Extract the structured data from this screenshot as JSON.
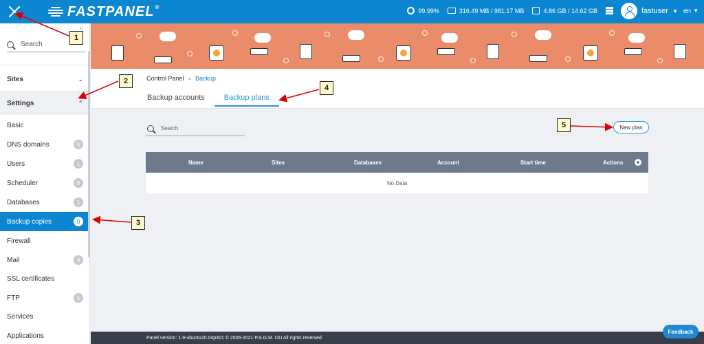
{
  "topbar": {
    "logo_text": "FASTPANEL",
    "logo_reg": "®",
    "uptime": "99.99%",
    "ram": "316.49 MB / 981.17 MB",
    "disk": "4.86 GB / 14.62 GB",
    "username": "fastuser",
    "language": "en",
    "brand_color": "#0d86d1"
  },
  "sidebar": {
    "search_placeholder": "Search",
    "sections": {
      "sites": "Sites",
      "settings": "Settings"
    },
    "items": [
      {
        "label": "Basic",
        "badge": ""
      },
      {
        "label": "DNS domains",
        "badge": "0"
      },
      {
        "label": "Users",
        "badge": "1"
      },
      {
        "label": "Scheduler",
        "badge": "0"
      },
      {
        "label": "Databases",
        "badge": "1"
      },
      {
        "label": "Backup copies",
        "badge": "0"
      },
      {
        "label": "Firewall",
        "badge": ""
      },
      {
        "label": "Mail",
        "badge": "0"
      },
      {
        "label": "SSL certificates",
        "badge": ""
      },
      {
        "label": "FTP",
        "badge": "1"
      },
      {
        "label": "Services",
        "badge": ""
      },
      {
        "label": "Applications",
        "badge": ""
      }
    ]
  },
  "breadcrumb": {
    "root": "Control Panel",
    "separator": "»",
    "current": "Backup"
  },
  "tabs": {
    "accounts": "Backup accounts",
    "plans": "Backup plans"
  },
  "content": {
    "search_placeholder": "Search",
    "new_plan": "New plan",
    "columns": [
      "Name",
      "Sites",
      "Databases",
      "Account",
      "Start time",
      "Actions"
    ],
    "empty": "No Data"
  },
  "footer": {
    "version": "Panel version: 1.9-ubuntu20.04p301 © 2006-2021 P.A.G.M. OU All rights reserved"
  },
  "feedback": "Feedback",
  "annotations": [
    "1",
    "2",
    "3",
    "4",
    "5"
  ]
}
